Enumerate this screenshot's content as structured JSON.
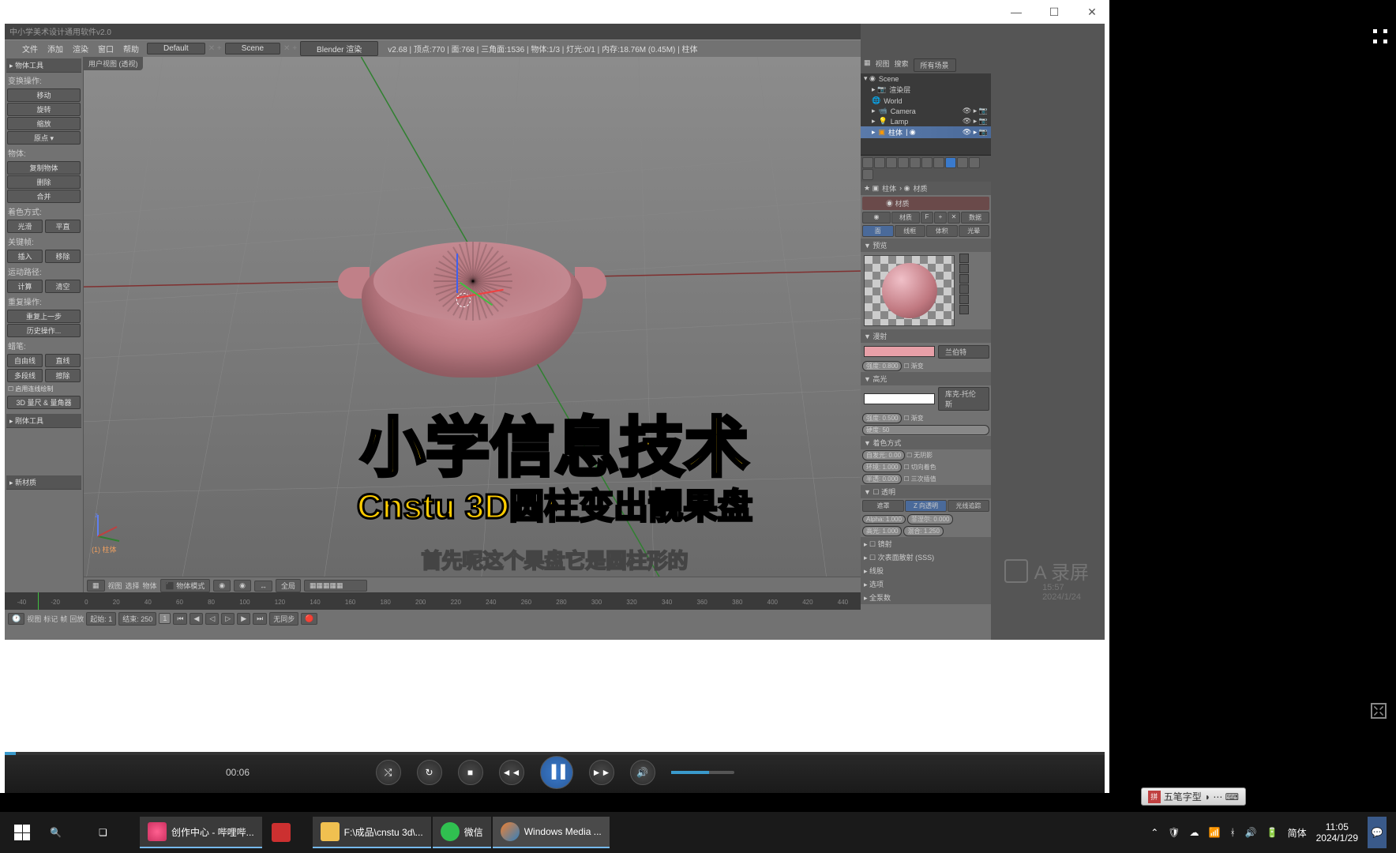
{
  "window": {
    "min": "—",
    "max": "☐",
    "close": "✕"
  },
  "blender": {
    "title_prefix": "中小学美术设计通用软件v2.0",
    "menu": [
      "文件",
      "添加",
      "渲染",
      "窗口",
      "帮助"
    ],
    "layout_label": "Default",
    "scene_label": "Scene",
    "renderer": "Blender 渲染",
    "stats": "v2.68 | 顶点:770 | 面:768 | 三角面:1536 | 物体:1/3 | 灯光:0/1 | 内存:18.76M (0.45M) | 柱体",
    "viewport_label": "用户视图 (透视)",
    "viewport_object": "(1) 柱体"
  },
  "left": {
    "header": "物体工具",
    "transform_label": "变换操作:",
    "transform": [
      "移动",
      "旋转",
      "缩放"
    ],
    "origin": "原点",
    "object_label": "物体:",
    "object_ops": [
      "复制物体",
      "删除",
      "合并"
    ],
    "shade_label": "着色方式:",
    "shade": [
      "光滑",
      "平直"
    ],
    "keyframe_label": "关键帧:",
    "keyframe": [
      "插入",
      "移除"
    ],
    "path_label": "运动路径:",
    "path": [
      "计算",
      "清空"
    ],
    "repeat_label": "重复操作:",
    "repeat": "重复上一步",
    "history": "历史操作...",
    "gp_label": "蜡笔:",
    "gp": [
      "自由线",
      "直线",
      "多段线",
      "擦除"
    ],
    "gp_cont": "启用连线绘制",
    "ruler": "3D 量尺 & 量角器",
    "rigid": "刚体工具",
    "newmat": "新材质"
  },
  "outliner": {
    "tabs": [
      "视图",
      "搜索",
      "所有场景"
    ],
    "scene": "Scene",
    "render_layer": "渲染层",
    "world": "World",
    "camera": "Camera",
    "lamp": "Lamp",
    "active": "柱体"
  },
  "props": {
    "object_name": "柱体",
    "material_label": "材质",
    "material_name": "材质",
    "data_btn": "数据",
    "mat_btn": "材质",
    "f_btn": "F",
    "render_tabs": [
      "面",
      "线框",
      "体积",
      "光晕"
    ],
    "preview": "预览",
    "diffuse": "漫射",
    "diffuse_model": "兰伯特",
    "intensity_label": "强度: 0.800",
    "gradient": "渐变",
    "specular": "高光",
    "spec_model": "库克-托伦斯",
    "spec_intensity": "强度: 0.500",
    "hardness": "硬度: 50",
    "shading": "着色方式",
    "emit": "自发光: 0.00",
    "shadeless": "无阴影",
    "ambient": "环境: 1.000",
    "tangent": "切向着色",
    "translucent": "半透: 0.000",
    "cubic": "三次插值",
    "transparency": "透明",
    "mask": "遮罩",
    "z_transp": "Z 向透明",
    "raytrace": "光线追踪",
    "alpha": "Alpha: 1.000",
    "fresnel": "菲涅尔: 0.000",
    "spec_val": "高光: 1.000",
    "blend": "混合: 1.250",
    "mirror": "镜射",
    "sss": "次表面散射 (SSS)",
    "strand": "线股",
    "options": "选项",
    "passes": "全泵数"
  },
  "viewport_bottom": {
    "items": [
      "视图",
      "选择",
      "物体"
    ],
    "mode": "物体模式",
    "global": "全局"
  },
  "timeline": {
    "menu": [
      "视图",
      "标记",
      "帧",
      "回放"
    ],
    "start_label": "起始: 1",
    "end_label": "结束: 250",
    "current": "1",
    "sync": "无同步",
    "numbers": [
      "-40",
      "-20",
      "0",
      "20",
      "40",
      "60",
      "80",
      "100",
      "120",
      "140",
      "160",
      "180",
      "200",
      "220",
      "240",
      "260",
      "280",
      "300",
      "320",
      "340",
      "360",
      "380",
      "400",
      "420",
      "440"
    ]
  },
  "overlay": {
    "title1": "小学信息技术",
    "title2": "Cnstu 3D圆柱变出靓果盘",
    "subtitle": "首先呢这个果盘它是圆柱形的"
  },
  "watermark": "录屏",
  "watermark_time": "15:57",
  "watermark_date": "2024/1/24",
  "media": {
    "time": "00:06",
    "shuffle": "⤭",
    "repeat": "↻",
    "stop": "■",
    "prev": "◄◄",
    "play": "▐▐",
    "next": "►►",
    "vol": "🔊"
  },
  "ime": {
    "label": "五笔字型"
  },
  "taskbar": {
    "items": [
      {
        "label": "创作中心 - 哔哩哔...",
        "color": "#1a1a1a"
      },
      {
        "label": "",
        "color": "#cc3030"
      },
      {
        "label": "F:\\成品\\cnstu 3d\\...",
        "color": "#f0c050"
      },
      {
        "label": "微信",
        "color": "#30c050"
      },
      {
        "label": "Windows Media ...",
        "color": "#f08030"
      }
    ],
    "tray": {
      "lang": "简体",
      "time": "11:05",
      "date": "2024/1/29"
    }
  }
}
